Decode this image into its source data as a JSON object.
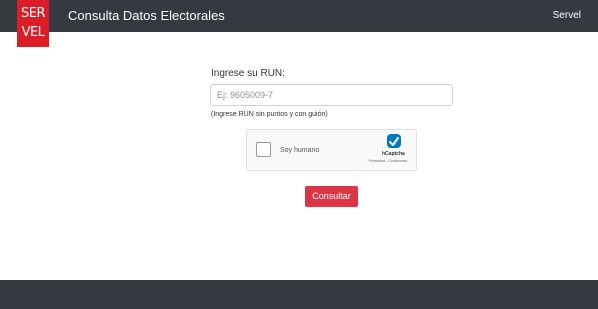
{
  "header": {
    "logo_line1": "SER",
    "logo_line2": "VEL",
    "title": "Consulta Datos Electorales",
    "nav_link": "Servel"
  },
  "form": {
    "run_label": "Ingrese su RUN:",
    "run_value": "",
    "run_placeholder": "Ej: 9605009-7",
    "run_help": "(Ingrese RUN sin puntos y con guión)",
    "submit_label": "Consultar"
  },
  "captcha": {
    "checkbox_label": "Soy humano",
    "brand": "hCaptcha",
    "links": "Privacidad - Condiciones",
    "icon": "hcaptcha-logo-icon"
  },
  "colors": {
    "navbar": "#343a40",
    "logo": "#dc1c26",
    "button": "#dc3545",
    "captcha_logo": "#0074bf"
  }
}
